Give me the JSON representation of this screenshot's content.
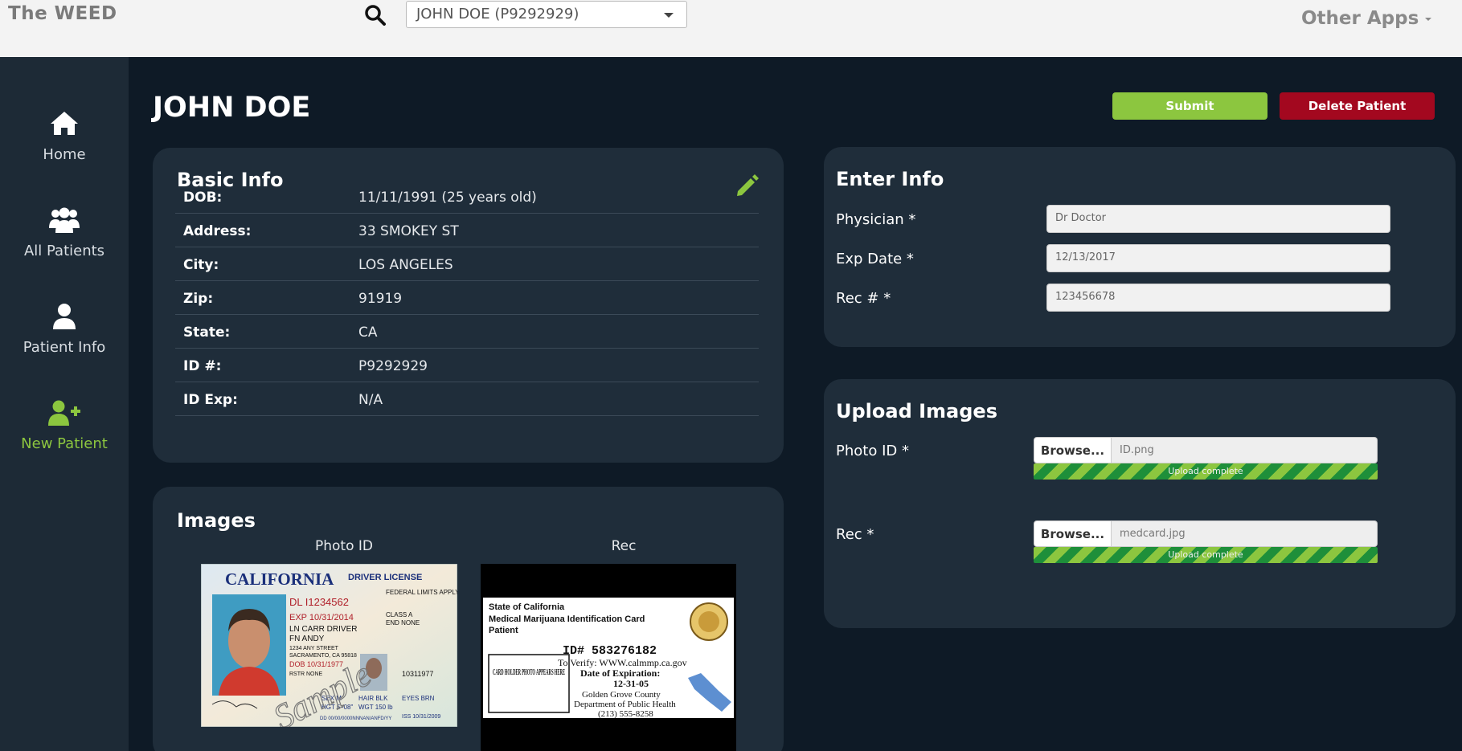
{
  "header": {
    "brand": "The WEED",
    "patient_select": "JOHN DOE (P9292929)",
    "other_apps": "Other Apps"
  },
  "sidebar": {
    "items": [
      {
        "label": "Home",
        "icon": "home-icon"
      },
      {
        "label": "All Patients",
        "icon": "users-icon"
      },
      {
        "label": "Patient Info",
        "icon": "user-icon"
      },
      {
        "label": "New Patient",
        "icon": "user-plus-icon",
        "active": true
      }
    ]
  },
  "page": {
    "title": "JOHN DOE",
    "submit_label": "Submit",
    "delete_label": "Delete Patient"
  },
  "basic_info": {
    "title": "Basic Info",
    "rows": [
      {
        "key": "DOB:",
        "value": "11/11/1991 (25 years old)"
      },
      {
        "key": "Address:",
        "value": "33 SMOKEY ST"
      },
      {
        "key": "City:",
        "value": "LOS ANGELES"
      },
      {
        "key": "Zip:",
        "value": "91919"
      },
      {
        "key": "State:",
        "value": "CA"
      },
      {
        "key": "ID #:",
        "value": "P9292929"
      },
      {
        "key": "ID Exp:",
        "value": "N/A"
      }
    ]
  },
  "images": {
    "title": "Images",
    "photo_id_caption": "Photo ID",
    "rec_caption": "Rec",
    "license": {
      "state": "CALIFORNIA",
      "type": "DRIVER LICENSE",
      "dl": "DL I1234562",
      "exp": "EXP 10/31/2014",
      "ln": "LN CARR DRIVER",
      "fn": "FN ANDY",
      "address": "1234 ANY STREET",
      "city": "SACRAMENTO, CA 95818",
      "dob": "DOB 10/31/1977",
      "rstr": "RSTR NONE",
      "restrictions": "FEDERAL LIMITS APPLY",
      "class": "CLASS A",
      "end": "END NONE",
      "number": "10311977",
      "sex": "SEX M",
      "hair": "HAIR BLK",
      "eyes": "EYES BRN",
      "hgt": "HGT 5'-08\"",
      "wgt": "WGT 150 lb",
      "iss": "ISS 10/31/2009",
      "dd": "DD 00/00/0000NNNAN/ANFD/YY",
      "watermark": "Sample"
    },
    "medcard": {
      "state": "State of California",
      "title": "Medical Marijuana Identification Card",
      "patient": "Patient",
      "photo_text": "CARD HOLDER PHOTO APPEARS HERE",
      "id": "ID# 583276182",
      "verify": "To Verify: WWW.calmmp.ca.gov",
      "exp_label": "Date of Expiration:",
      "exp_date": "12-31-05",
      "county": "Golden Grove County",
      "dept": "Department of Public Health",
      "phone": "(213) 555-8258"
    }
  },
  "enter_info": {
    "title": "Enter Info",
    "fields": [
      {
        "label": "Physician *",
        "value": "Dr Doctor"
      },
      {
        "label": "Exp Date *",
        "value": "12/13/2017"
      },
      {
        "label": "Rec # *",
        "value": "123456678"
      }
    ]
  },
  "upload": {
    "title": "Upload Images",
    "browse_label": "Browse...",
    "items": [
      {
        "label": "Photo ID *",
        "file": "ID.png",
        "status": "Upload complete",
        "progress": 1.0
      },
      {
        "label": "Rec *",
        "file": "medcard.jpg",
        "status": "Upload complete",
        "progress": 1.0
      }
    ]
  },
  "colors": {
    "accent_green": "#8cc63f",
    "danger_red": "#a3081f",
    "background": "#0e1a26",
    "card": "#1f2d3a"
  }
}
